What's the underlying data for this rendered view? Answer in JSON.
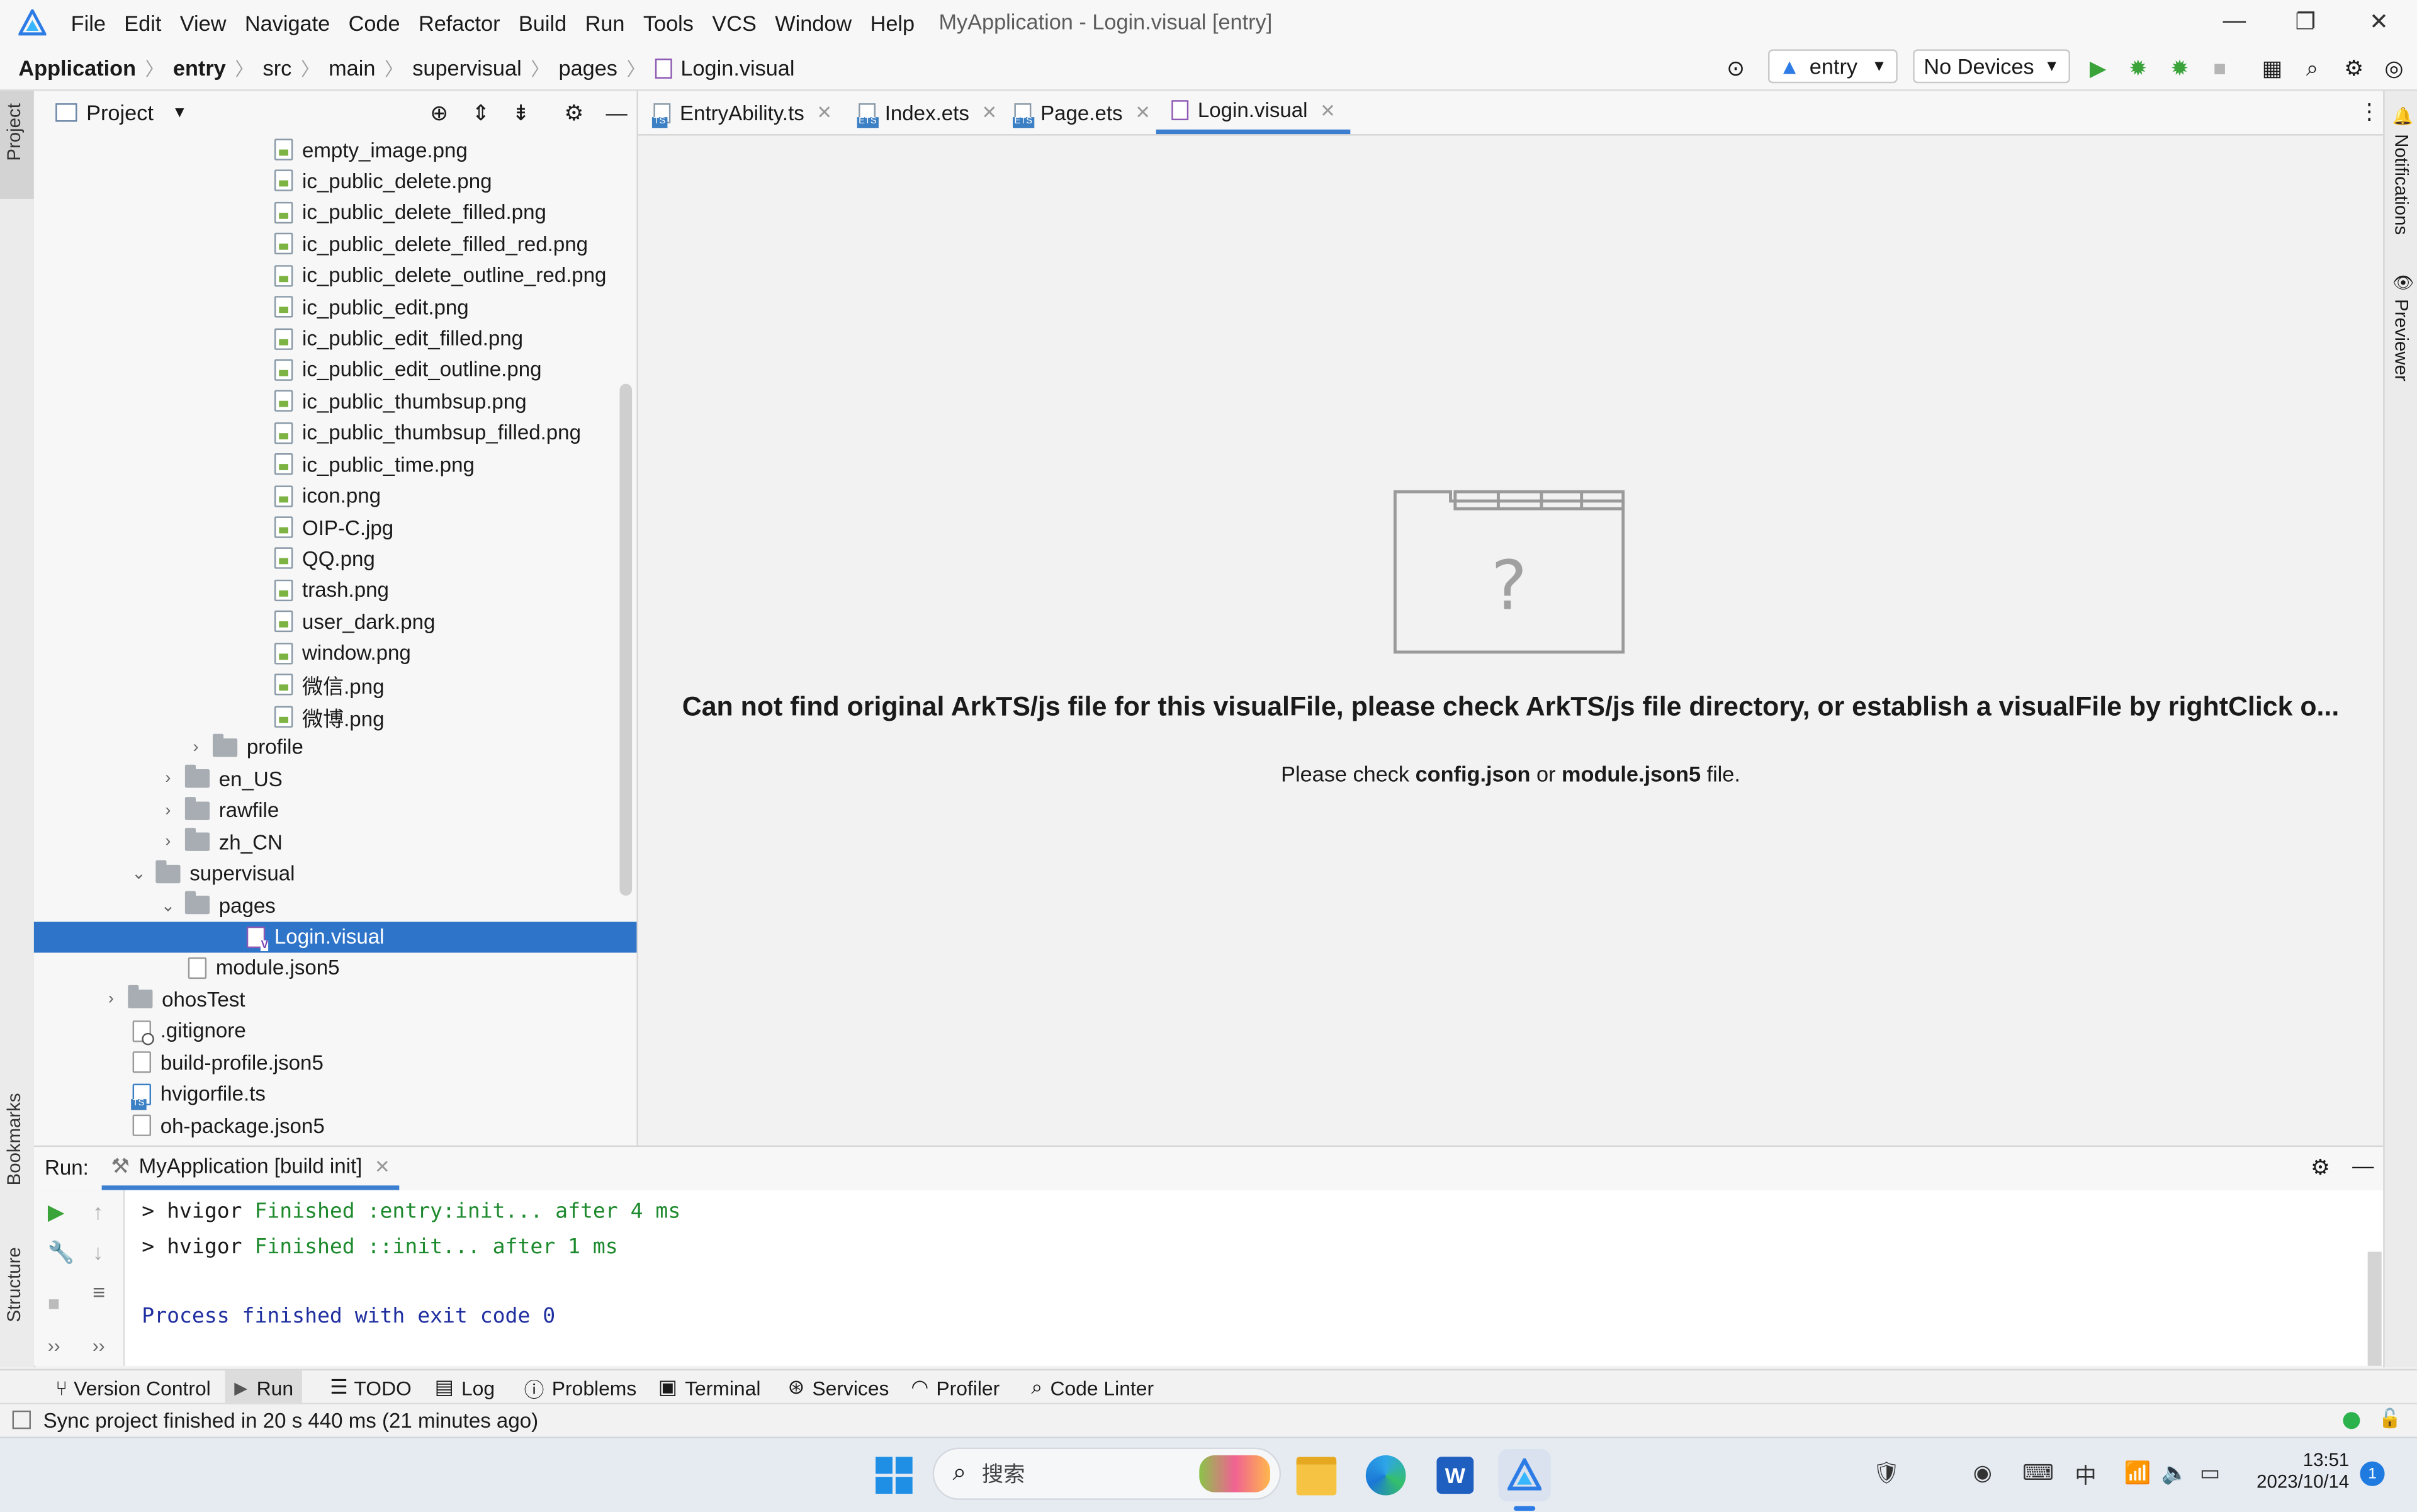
{
  "menubar": {
    "items": [
      "File",
      "Edit",
      "View",
      "Navigate",
      "Code",
      "Refactor",
      "Build",
      "Run",
      "Tools",
      "VCS",
      "Window",
      "Help"
    ],
    "window_title": "MyApplication - Login.visual [entry]"
  },
  "breadcrumb": [
    "Application",
    "entry",
    "src",
    "main",
    "supervisual",
    "pages",
    "Login.visual"
  ],
  "toolbar": {
    "config": "entry",
    "device": "No Devices"
  },
  "project_panel": {
    "title": "Project",
    "tree": [
      {
        "label": "empty_image.png",
        "type": "img",
        "indent": 178
      },
      {
        "label": "ic_public_delete.png",
        "type": "img",
        "indent": 178
      },
      {
        "label": "ic_public_delete_filled.png",
        "type": "img",
        "indent": 178
      },
      {
        "label": "ic_public_delete_filled_red.png",
        "type": "img",
        "indent": 178
      },
      {
        "label": "ic_public_delete_outline_red.png",
        "type": "img",
        "indent": 178
      },
      {
        "label": "ic_public_edit.png",
        "type": "img",
        "indent": 178
      },
      {
        "label": "ic_public_edit_filled.png",
        "type": "img",
        "indent": 178
      },
      {
        "label": "ic_public_edit_outline.png",
        "type": "img",
        "indent": 178
      },
      {
        "label": "ic_public_thumbsup.png",
        "type": "img",
        "indent": 178
      },
      {
        "label": "ic_public_thumbsup_filled.png",
        "type": "img",
        "indent": 178
      },
      {
        "label": "ic_public_time.png",
        "type": "img",
        "indent": 178
      },
      {
        "label": "icon.png",
        "type": "img",
        "indent": 178
      },
      {
        "label": "OIP-C.jpg",
        "type": "img",
        "indent": 178
      },
      {
        "label": "QQ.png",
        "type": "img",
        "indent": 178
      },
      {
        "label": "trash.png",
        "type": "img",
        "indent": 178
      },
      {
        "label": "user_dark.png",
        "type": "img",
        "indent": 178
      },
      {
        "label": "window.png",
        "type": "img",
        "indent": 178
      },
      {
        "label": "微信.png",
        "type": "img",
        "indent": 178
      },
      {
        "label": "微博.png",
        "type": "img",
        "indent": 178
      },
      {
        "label": "profile",
        "type": "folder",
        "indent": 138,
        "chevron": "›"
      },
      {
        "label": "en_US",
        "type": "folder",
        "indent": 120,
        "chevron": "›"
      },
      {
        "label": "rawfile",
        "type": "folder",
        "indent": 120,
        "chevron": "›"
      },
      {
        "label": "zh_CN",
        "type": "folder",
        "indent": 120,
        "chevron": "›"
      },
      {
        "label": "supervisual",
        "type": "folder",
        "indent": 101,
        "chevron": "⌄"
      },
      {
        "label": "pages",
        "type": "folder",
        "indent": 120,
        "chevron": "⌄"
      },
      {
        "label": "Login.visual",
        "type": "vis",
        "indent": 160,
        "selected": true
      },
      {
        "label": "module.json5",
        "type": "json",
        "indent": 122
      },
      {
        "label": "ohosTest",
        "type": "folder",
        "indent": 83,
        "chevron": "›"
      },
      {
        "label": ".gitignore",
        "type": "git",
        "indent": 86
      },
      {
        "label": "build-profile.json5",
        "type": "json",
        "indent": 86
      },
      {
        "label": "hvigorfile.ts",
        "type": "ts",
        "indent": 86
      },
      {
        "label": "oh-package.json5",
        "type": "json",
        "indent": 86
      }
    ]
  },
  "editor_tabs": [
    {
      "label": "EntryAbility.ts",
      "icon": "ts",
      "active": false
    },
    {
      "label": "Index.ets",
      "icon": "ets",
      "active": false
    },
    {
      "label": "Page.ets",
      "icon": "ets",
      "active": false
    },
    {
      "label": "Login.visual",
      "icon": "vis",
      "active": true
    }
  ],
  "editor": {
    "error_title": "Can not find original ArkTS/js file for this visualFile, please check ArkTS/js file directory, or establish a visualFile by rightClick o...",
    "sub_prefix": "Please check ",
    "sub_file1": "config.json",
    "sub_or": " or ",
    "sub_file2": "module.json5",
    "sub_suffix": " file.",
    "placeholder_glyph": "?"
  },
  "side_tabs": {
    "left": [
      "Project",
      "Bookmarks",
      "Structure"
    ],
    "right": [
      "Notifications",
      "Previewer"
    ]
  },
  "run_panel": {
    "label": "Run:",
    "tab": "MyApplication [build init]",
    "lines": [
      {
        "prefix": "> hvigor ",
        "text": "Finished :entry:init... after 4 ms"
      },
      {
        "prefix": "> hvigor ",
        "text": "Finished ::init... after 1 ms"
      }
    ],
    "exit": "Process finished with exit code 0"
  },
  "tool_windows": [
    "Version Control",
    "Run",
    "TODO",
    "Log",
    "Problems",
    "Terminal",
    "Services",
    "Profiler",
    "Code Linter"
  ],
  "status": "Sync project finished in 20 s 440 ms (21 minutes ago)",
  "taskbar": {
    "search_placeholder": "搜索",
    "ime": "中",
    "time": "13:51",
    "date": "2023/10/14",
    "notif_count": "1"
  }
}
